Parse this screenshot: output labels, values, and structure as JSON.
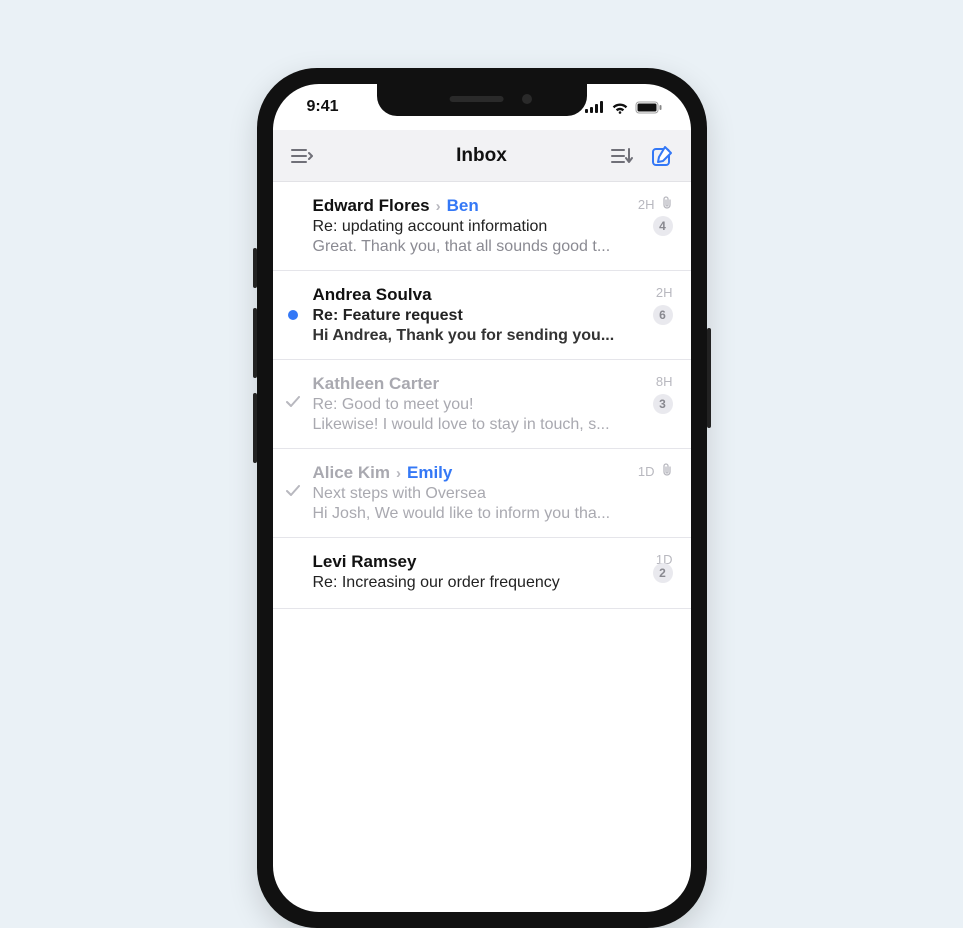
{
  "status": {
    "time": "9:41"
  },
  "header": {
    "title": "Inbox"
  },
  "messages": [
    {
      "sender": "Edward Flores",
      "recipient": "Ben",
      "subject": "Re: updating account information",
      "preview": "Great. Thank you, that all sounds good t...",
      "time": "2H",
      "count": "4",
      "unread": false,
      "done": false,
      "attachment": true
    },
    {
      "sender": "Andrea Soulva",
      "recipient": "",
      "subject": "Re: Feature request",
      "preview": "Hi Andrea, Thank you for sending you...",
      "time": "2H",
      "count": "6",
      "unread": true,
      "done": false,
      "attachment": false
    },
    {
      "sender": "Kathleen Carter",
      "recipient": "",
      "subject": "Re: Good to meet you!",
      "preview": "Likewise! I would love to stay in touch, s...",
      "time": "8H",
      "count": "3",
      "unread": false,
      "done": true,
      "attachment": false
    },
    {
      "sender": "Alice Kim",
      "recipient": "Emily",
      "subject": "Next steps with Oversea",
      "preview": "Hi Josh, We would like to inform you tha...",
      "time": "1D",
      "count": "",
      "unread": false,
      "done": true,
      "attachment": true
    },
    {
      "sender": "Levi Ramsey",
      "recipient": "",
      "subject": "Re: Increasing our order frequency",
      "preview": "",
      "time": "1D",
      "count": "2",
      "unread": false,
      "done": false,
      "attachment": false
    }
  ]
}
